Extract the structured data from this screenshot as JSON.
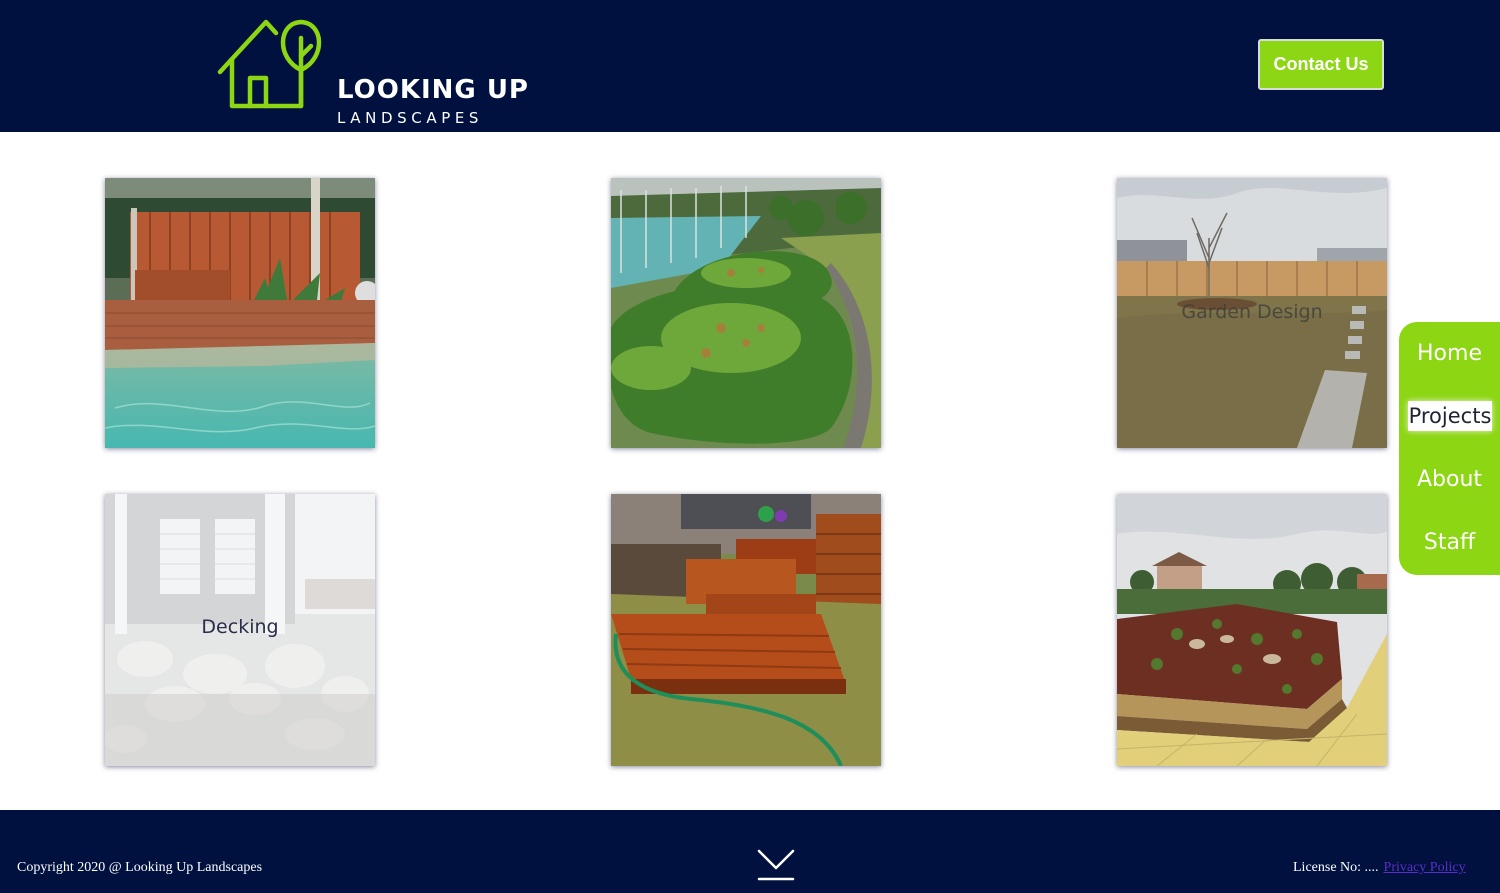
{
  "brand": {
    "name_line1": "LOOKING UP",
    "name_line2": "LANDSCAPES",
    "logo_color": "#8cd613"
  },
  "header": {
    "background": "#001140",
    "contact_label": "Contact Us"
  },
  "gallery": [
    {
      "image": "pool-deck-photo",
      "label": ""
    },
    {
      "image": "hedge-garden-photo",
      "label": ""
    },
    {
      "image": "lawn-garden-photo",
      "label": "Garden Design"
    },
    {
      "image": "decking-photo",
      "label": "Decking"
    },
    {
      "image": "timber-steps-photo",
      "label": ""
    },
    {
      "image": "garden-bed-photo",
      "label": ""
    }
  ],
  "nav": {
    "items": [
      "Home",
      "Projects",
      "About",
      "Staff"
    ],
    "active": "Projects",
    "accent": "#8cd613"
  },
  "footer": {
    "copyright": "Copyright 2020 @ Looking Up Landscapes",
    "license_label": "License No: ....",
    "privacy_label": "Privacy Policy",
    "scroll_icon": "chevron-down-icon"
  }
}
